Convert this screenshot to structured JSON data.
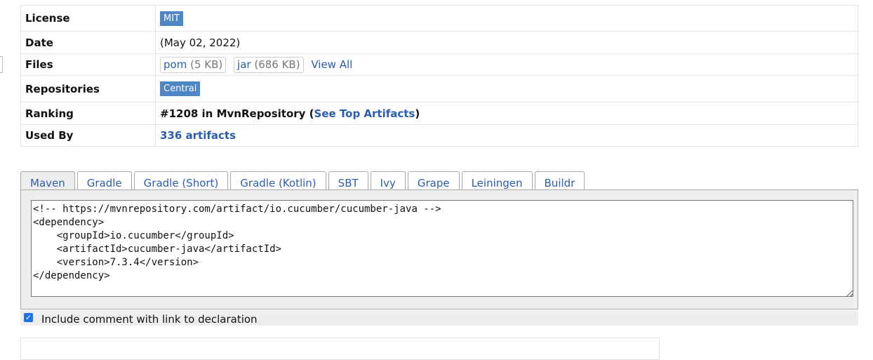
{
  "info": {
    "rows": [
      {
        "label": "License",
        "badge": "MIT"
      },
      {
        "label": "Date",
        "value": "(May 02, 2022)"
      },
      {
        "label": "Files",
        "files": [
          {
            "name": "pom",
            "size": "(5 KB)"
          },
          {
            "name": "jar",
            "size": "(686 KB)"
          }
        ],
        "view_all": "View All"
      },
      {
        "label": "Repositories",
        "badge": "Central"
      },
      {
        "label": "Ranking",
        "prefix": "#1208 in MvnRepository (",
        "link": "See Top Artifacts",
        "suffix": ")"
      },
      {
        "label": "Used By",
        "link": "336 artifacts"
      }
    ]
  },
  "tabs": [
    {
      "label": "Maven",
      "active": true
    },
    {
      "label": "Gradle"
    },
    {
      "label": "Gradle (Short)"
    },
    {
      "label": "Gradle (Kotlin)"
    },
    {
      "label": "SBT"
    },
    {
      "label": "Ivy"
    },
    {
      "label": "Grape"
    },
    {
      "label": "Leiningen"
    },
    {
      "label": "Buildr"
    }
  ],
  "code": "<!-- https://mvnrepository.com/artifact/io.cucumber/cucumber-java -->\n<dependency>\n    <groupId>io.cucumber</groupId>\n    <artifactId>cucumber-java</artifactId>\n    <version>7.3.4</version>\n</dependency>",
  "include_comment": {
    "checked": true,
    "label": "Include comment with link to declaration"
  },
  "colors": {
    "badge": "#4f86c6",
    "link": "#2a5db0",
    "checkbox": "#1a73e8"
  }
}
